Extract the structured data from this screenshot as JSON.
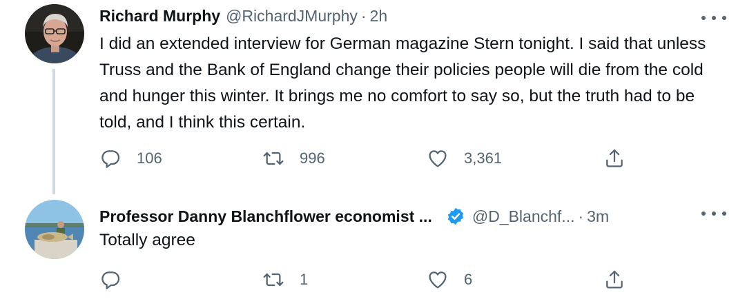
{
  "tweets": [
    {
      "author_name": "Richard Murphy",
      "handle": "@RichardJMurphy",
      "separator": "·",
      "time": "2h",
      "text": "I did an extended interview for German magazine Stern tonight. I said that unless Truss and the Bank of England change their policies people will die from the cold and hunger this winter. It brings me no comfort to say so, but the truth had to be told, and I think this certain.",
      "replies": "106",
      "retweets": "996",
      "likes": "3,361",
      "verified": false
    },
    {
      "author_name": "Professor Danny Blanchflower economist ...",
      "handle": "@D_Blanchf...",
      "separator": "·",
      "time": "3m",
      "text": "Totally agree",
      "replies": "",
      "retweets": "1",
      "likes": "6",
      "verified": true
    }
  ],
  "colors": {
    "text": "#0f1419",
    "secondary": "#536471",
    "verified": "#1d9bf0",
    "thread_line": "#cfd9de"
  },
  "icons": [
    "reply-icon",
    "retweet-icon",
    "like-icon",
    "share-icon",
    "more-icon",
    "verified-badge-icon"
  ]
}
